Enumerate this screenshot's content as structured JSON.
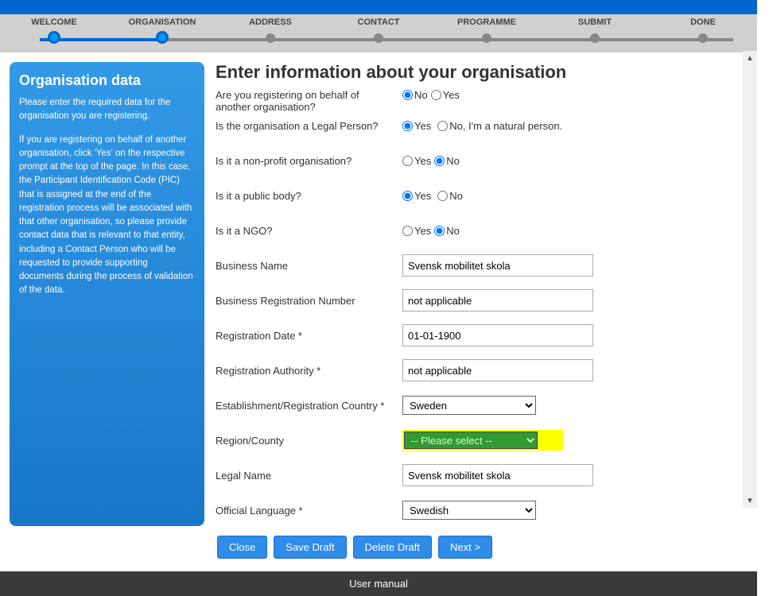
{
  "stepper": {
    "steps": [
      {
        "label": "WELCOME",
        "state": "done"
      },
      {
        "label": "ORGANISATION",
        "state": "active"
      },
      {
        "label": "ADDRESS",
        "state": "pending"
      },
      {
        "label": "CONTACT",
        "state": "pending"
      },
      {
        "label": "PROGRAMME",
        "state": "pending"
      },
      {
        "label": "SUBMIT",
        "state": "pending"
      },
      {
        "label": "DONE",
        "state": "pending"
      }
    ]
  },
  "sidebar": {
    "title": "Organisation data",
    "p1": "Please enter the required data for the organisation you are registering.",
    "p2": "If you are registering on behalf of another organisation, click 'Yes' on the respective prompt at the top of the page. In this case, the Participant Identification Code (PIC) that is assigned at the end of the registration process will be associated with that other organisation, so please provide contact data that is relevant to that entity, including a Contact Person who will be requested to provide supporting documents during the process of validation of the data."
  },
  "main": {
    "title": "Enter information about your organisation",
    "q_behalf": "Are you registering on behalf of another organisation?",
    "q_legal": "Is the organisation a Legal Person?",
    "q_nonprofit": "Is it a non-profit organisation?",
    "q_public": "Is it a public body?",
    "q_ngo": "Is it a NGO?",
    "l_business_name": "Business Name",
    "l_business_reg": "Business Registration Number",
    "l_reg_date": "Registration Date *",
    "l_reg_auth": "Registration Authority *",
    "l_country": "Establishment/Registration Country *",
    "l_region": "Region/County",
    "l_legal_name": "Legal Name",
    "l_language": "Official Language *",
    "opt_no": "No",
    "opt_yes": "Yes",
    "opt_natural": "No, I'm a natural person.",
    "v_business_name": "Svensk mobilitet skola",
    "v_business_reg": "not applicable",
    "v_reg_date": "01-01-1900",
    "v_reg_auth": "not applicable",
    "v_country": "Sweden",
    "v_region": "-- Please select --",
    "v_legal_name": "Svensk mobilitet skola",
    "v_language": "Swedish"
  },
  "buttons": {
    "close": "Close",
    "save": "Save Draft",
    "delete": "Delete Draft",
    "next": "Next >"
  },
  "footer": {
    "link": "User manual"
  }
}
